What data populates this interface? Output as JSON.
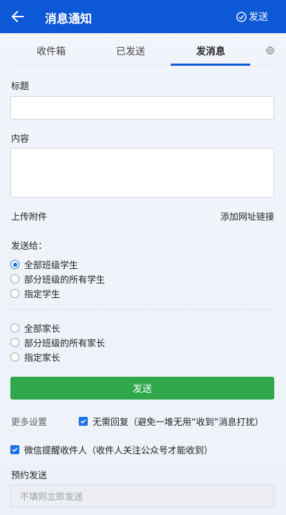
{
  "header": {
    "title": "消息通知",
    "send_label": "发送"
  },
  "tabs": [
    {
      "label": "收件箱"
    },
    {
      "label": "已发送"
    },
    {
      "label": "发消息",
      "active": true
    }
  ],
  "form": {
    "title_label": "标题",
    "title_value": "",
    "content_label": "内容",
    "content_value": "",
    "upload_label": "上传附件",
    "add_link_label": "添加网址链接",
    "send_to_label": "发送给：",
    "student_options": [
      {
        "label": "全部班级学生",
        "checked": true
      },
      {
        "label": "部分班级的所有学生",
        "checked": false
      },
      {
        "label": "指定学生",
        "checked": false
      }
    ],
    "parent_options": [
      {
        "label": "全部家长",
        "checked": false
      },
      {
        "label": "部分班级的所有家长",
        "checked": false
      },
      {
        "label": "指定家长",
        "checked": false
      }
    ],
    "send_button": "发送",
    "more_settings": "更多设置",
    "no_reply_label": "无需回复（避免一堆无用“收到”消息打扰）",
    "wechat_label": "微信提醒收件人（收件人关注公众号才能收到）",
    "schedule_label": "预约发送",
    "schedule_placeholder": "不填则立即发送"
  },
  "colors": {
    "primary": "#0d58d6",
    "send_button": "#2ea84a",
    "checkbox": "#1a73e8"
  }
}
